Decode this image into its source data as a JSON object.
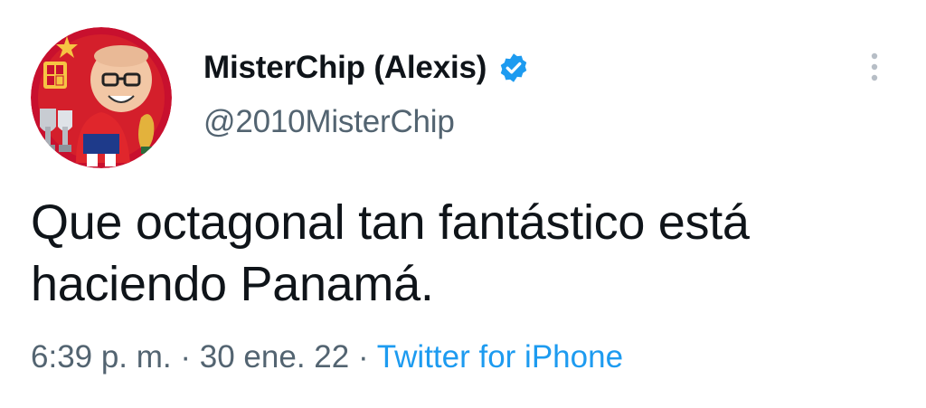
{
  "user": {
    "display_name": "MisterChip (Alexis)",
    "handle": "@2010MisterChip",
    "verified_icon": "verified-badge",
    "avatar": "cartoon-avatar"
  },
  "tweet": {
    "text": "Que octagonal tan fantástico está haciendo Panamá."
  },
  "meta": {
    "time": "6:39 p. m.",
    "separator": "·",
    "date": "30 ene. 22",
    "source": "Twitter for iPhone"
  },
  "colors": {
    "text": "#0f1419",
    "secondary": "#536471",
    "accent": "#1d9bf0",
    "avatar_bg": "#c8102e"
  },
  "icons": {
    "more": "more-vertical-icon",
    "verified": "verified-badge-icon"
  }
}
